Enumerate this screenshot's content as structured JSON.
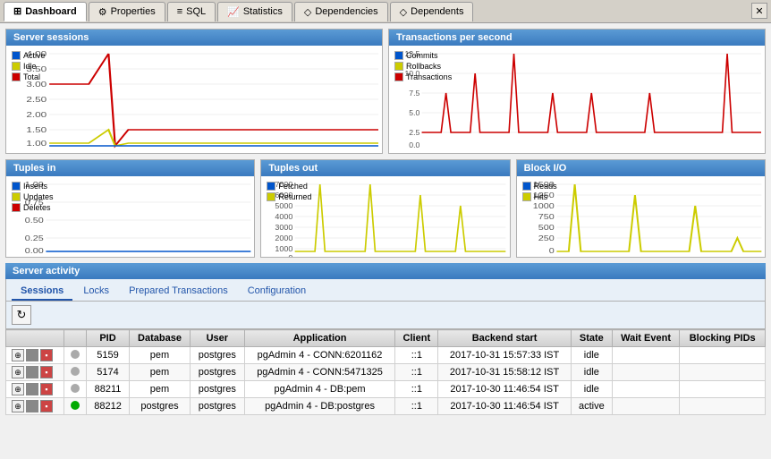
{
  "tabs": [
    {
      "id": "dashboard",
      "label": "Dashboard",
      "icon": "⊞",
      "active": true
    },
    {
      "id": "properties",
      "label": "Properties",
      "icon": "⚙"
    },
    {
      "id": "sql",
      "label": "SQL",
      "icon": "≡"
    },
    {
      "id": "statistics",
      "label": "Statistics",
      "icon": "📈"
    },
    {
      "id": "dependencies",
      "label": "Dependencies",
      "icon": "◇"
    },
    {
      "id": "dependents",
      "label": "Dependents",
      "icon": "◇"
    }
  ],
  "charts": {
    "server_sessions": {
      "title": "Server sessions",
      "legend": [
        {
          "label": "Active",
          "color": "#0055cc"
        },
        {
          "label": "Idle",
          "color": "#cccc00"
        },
        {
          "label": "Total",
          "color": "#cc0000"
        }
      ],
      "y_labels": [
        "4.00",
        "3.50",
        "3.00",
        "2.50",
        "2.00",
        "1.50",
        "1.00"
      ]
    },
    "transactions": {
      "title": "Transactions per second",
      "legend": [
        {
          "label": "Commits",
          "color": "#0055cc"
        },
        {
          "label": "Rollbacks",
          "color": "#cccc00"
        },
        {
          "label": "Transactions",
          "color": "#cc0000"
        }
      ],
      "y_labels": [
        "12.5",
        "10.0",
        "7.5",
        "5.0",
        "2.5",
        "0.0"
      ]
    },
    "tuples_in": {
      "title": "Tuples in",
      "legend": [
        {
          "label": "Inserts",
          "color": "#0055cc"
        },
        {
          "label": "Updates",
          "color": "#cccc00"
        },
        {
          "label": "Deletes",
          "color": "#cc0000"
        }
      ],
      "y_labels": [
        "1.00",
        "0.75",
        "0.50",
        "0.25",
        "0.00"
      ]
    },
    "tuples_out": {
      "title": "Tuples out",
      "legend": [
        {
          "label": "Fetched",
          "color": "#0055cc"
        },
        {
          "label": "Returned",
          "color": "#cccc00"
        }
      ],
      "y_labels": [
        "7000",
        "6000",
        "5000",
        "4000",
        "3000",
        "2000",
        "1000",
        "0"
      ]
    },
    "block_io": {
      "title": "Block I/O",
      "legend": [
        {
          "label": "Reads",
          "color": "#0055cc"
        },
        {
          "label": "Hits",
          "color": "#cccc00"
        }
      ],
      "y_labels": [
        "1500",
        "1250",
        "1000",
        "750",
        "500",
        "250",
        "0"
      ]
    }
  },
  "activity": {
    "section_title": "Server activity",
    "tabs": [
      "Sessions",
      "Locks",
      "Prepared Transactions",
      "Configuration"
    ],
    "active_tab": "Sessions",
    "columns": [
      "",
      "",
      "PID",
      "Database",
      "User",
      "Application",
      "Client",
      "Backend start",
      "State",
      "Wait Event",
      "Blocking PIDs"
    ],
    "rows": [
      {
        "pid": "5159",
        "database": "pem",
        "user": "postgres",
        "application": "pgAdmin 4 - CONN:6201162",
        "client": "::1",
        "backend_start": "2017-10-31 15:57:33 IST",
        "state": "idle",
        "wait_event": "",
        "blocking_pids": "",
        "state_color": "#aaaaaa"
      },
      {
        "pid": "5174",
        "database": "pem",
        "user": "postgres",
        "application": "pgAdmin 4 - CONN:5471325",
        "client": "::1",
        "backend_start": "2017-10-31 15:58:12 IST",
        "state": "idle",
        "wait_event": "",
        "blocking_pids": "",
        "state_color": "#aaaaaa"
      },
      {
        "pid": "88211",
        "database": "pem",
        "user": "postgres",
        "application": "pgAdmin 4 - DB:pem",
        "client": "::1",
        "backend_start": "2017-10-30 11:46:54 IST",
        "state": "idle",
        "wait_event": "",
        "blocking_pids": "",
        "state_color": "#aaaaaa"
      },
      {
        "pid": "88212",
        "database": "postgres",
        "user": "postgres",
        "application": "pgAdmin 4 - DB:postgres",
        "client": "::1",
        "backend_start": "2017-10-30 11:46:54 IST",
        "state": "active",
        "wait_event": "",
        "blocking_pids": "",
        "state_color": "#00aa00"
      }
    ]
  }
}
